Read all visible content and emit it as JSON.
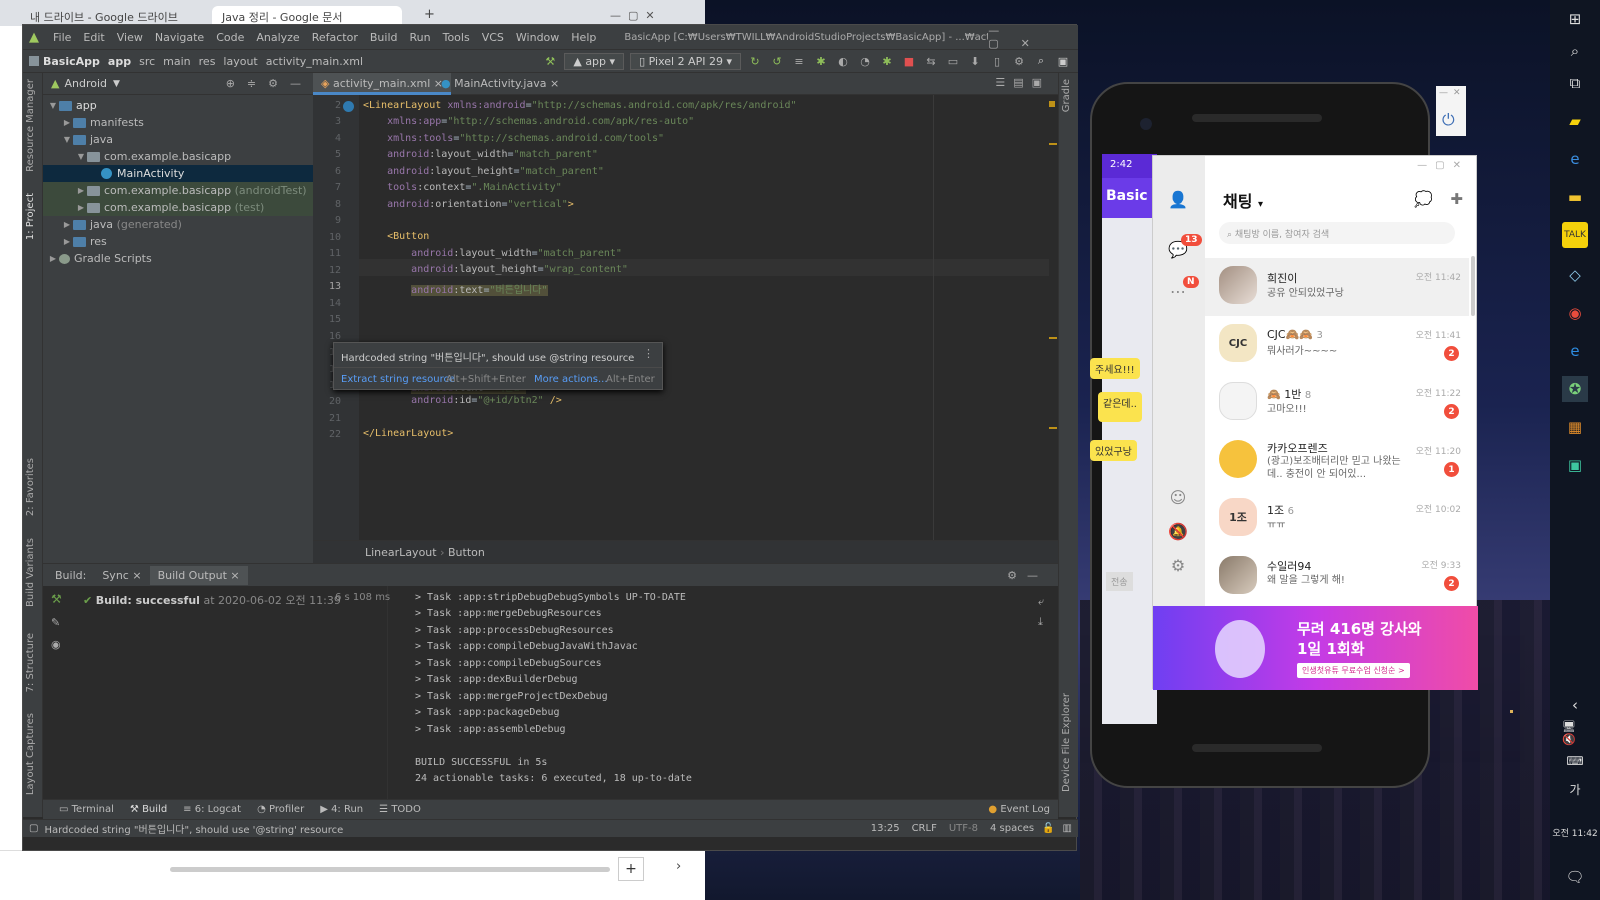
{
  "chrome": {
    "tabs": [
      "내 드라이브 - Google 드라이브",
      "Java 정리 - Google 문서"
    ],
    "new_tab": "+"
  },
  "as": {
    "menu": [
      "File",
      "Edit",
      "View",
      "Navigate",
      "Code",
      "Analyze",
      "Refactor",
      "Build",
      "Run",
      "Tools",
      "VCS",
      "Window",
      "Help"
    ],
    "title": "BasicApp [C:₩Users₩TWILL₩AndroidStudioProjects₩BasicApp] - ...₩activity_main.xml [app]",
    "breadcrumbs": [
      "BasicApp",
      "app",
      "src",
      "main",
      "res",
      "layout",
      "activity_main.xml"
    ],
    "run_config": "app",
    "device": "Pixel 2 API 29",
    "project_view": "Android",
    "tree": [
      {
        "label": "app",
        "depth": 0,
        "open": true
      },
      {
        "label": "manifests",
        "depth": 1,
        "open": false
      },
      {
        "label": "java",
        "depth": 1,
        "open": true
      },
      {
        "label": "com.example.basicapp",
        "depth": 2,
        "open": true
      },
      {
        "label": "MainActivity",
        "depth": 3
      },
      {
        "label": "com.example.basicapp",
        "suffix": "(androidTest)",
        "depth": 2,
        "open": false
      },
      {
        "label": "com.example.basicapp",
        "suffix": "(test)",
        "depth": 2,
        "open": false
      },
      {
        "label": "java",
        "suffix": "(generated)",
        "depth": 1,
        "open": false
      },
      {
        "label": "res",
        "depth": 1,
        "open": false
      },
      {
        "label": "Gradle Scripts",
        "depth": 0,
        "open": false
      }
    ],
    "editor_tabs": [
      "activity_main.xml",
      "MainActivity.java"
    ],
    "line_numbers": [
      "2",
      "3",
      "4",
      "5",
      "6",
      "7",
      "8",
      "9",
      "10",
      "11",
      "12",
      "13",
      "14",
      "15",
      "16",
      "17",
      "18",
      "19",
      "20",
      "21",
      "22"
    ],
    "tooltip": {
      "message": "Hardcoded string \"버튼입니다\", should use @string resource",
      "action1": "Extract string resource",
      "shortcut1": "Alt+Shift+Enter",
      "action2": "More actions...",
      "shortcut2": "Alt+Enter"
    },
    "editor_breadcrumb": [
      "LinearLayout",
      "Button"
    ],
    "side_labels": {
      "resource_manager": "Resource Manager",
      "project": "1: Project",
      "favorites": "2: Favorites",
      "build_variants": "Build Variants",
      "structure": "7: Structure",
      "layout_captures": "Layout Captures",
      "gradle": "Gradle",
      "device_file_explorer": "Device File Explorer"
    },
    "build": {
      "label": "Build:",
      "tabs": [
        "Sync",
        "Build Output"
      ],
      "result": "Build: successful",
      "result_suffix": "at 2020-06-02 오전 11:39",
      "duration": "6 s 108 ms",
      "output": [
        "> Task :app:stripDebugDebugSymbols UP-TO-DATE",
        "> Task :app:mergeDebugResources",
        "> Task :app:processDebugResources",
        "> Task :app:compileDebugJavaWithJavac",
        "> Task :app:compileDebugSources",
        "> Task :app:dexBuilderDebug",
        "> Task :app:mergeProjectDexDebug",
        "> Task :app:packageDebug",
        "> Task :app:assembleDebug",
        "",
        "BUILD SUCCESSFUL in 5s",
        "24 actionable tasks: 6 executed, 18 up-to-date"
      ]
    },
    "bottom_tabs": [
      "Terminal",
      "Build",
      "6: Logcat",
      "Profiler",
      "4: Run",
      "TODO"
    ],
    "event_log": "Event Log",
    "status": {
      "message": "Hardcoded string \"버튼입니다\", should use '@string' resource",
      "position": "13:25",
      "line_sep": "CRLF",
      "encoding": "UTF-8",
      "indent": "4 spaces"
    }
  },
  "emulator": {
    "time": "2:42",
    "app_title": "Basic",
    "bubbles": [
      "주세요!!!",
      "같은데..",
      "있었구낭"
    ],
    "send": "전송"
  },
  "kakao": {
    "title": "채팅",
    "search_placeholder": "채팅방 이름, 참여자 검색",
    "chat_badge": "13",
    "more_badge": "N",
    "chats": [
      {
        "name": "희진이",
        "count": "",
        "msg": "공유 안되있었구낭",
        "time": "오전 11:42",
        "badge": "",
        "color": "#c8b8a8"
      },
      {
        "name": "CJC🙈🙈",
        "count": "3",
        "msg": "뭐사러가~~~~",
        "time": "오전 11:41",
        "badge": "2",
        "color": "#f3e6c4",
        "avatar_text": "CJC"
      },
      {
        "name": "🙈 1반",
        "count": "8",
        "msg": "고마오!!!",
        "time": "오전 11:22",
        "badge": "2",
        "color": "#f4f4f4"
      },
      {
        "name": "카카오프렌즈",
        "count": "",
        "msg": "(광고)보조배터리만 믿고 나왔는데.. 충전이 안 되어있...",
        "time": "오전 11:20",
        "badge": "1",
        "color": "#f6c23d"
      },
      {
        "name": "1조",
        "count": "6",
        "msg": "ㅠㅠ",
        "time": "오전 10:02",
        "badge": "",
        "color": "#f8d7c6",
        "avatar_text": "1조"
      },
      {
        "name": "수일러94",
        "count": "",
        "msg": "왜 말을 그렇게 해!",
        "time": "오전 9:33",
        "badge": "2",
        "color": "#b6a698"
      }
    ],
    "ad": {
      "line1": "무려 416명 강사와",
      "line2": "1일 1회화",
      "cta": "인생첫유튜 무료수업 신청순 >"
    }
  },
  "taskbar": {
    "time": "오전 11:42",
    "ime": "가"
  }
}
